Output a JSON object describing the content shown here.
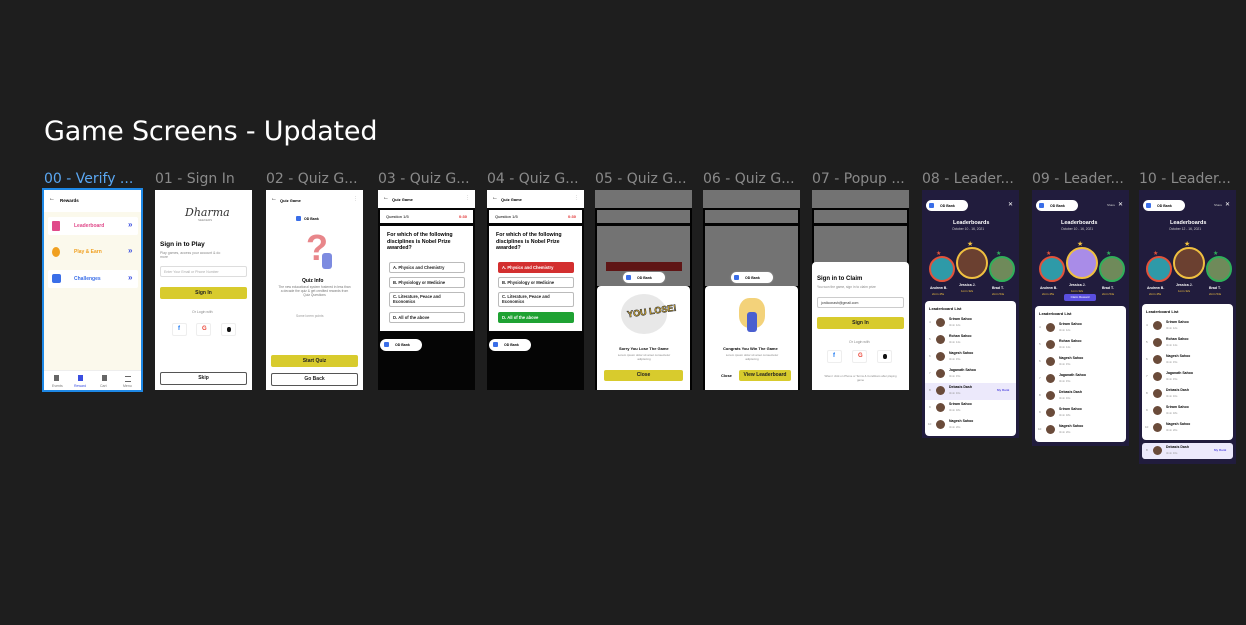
{
  "page": {
    "title": "Game Screens - Updated"
  },
  "frames": [
    {
      "label": "00 - Verify ..."
    },
    {
      "label": "01 - Sign In"
    },
    {
      "label": "02 - Quiz G..."
    },
    {
      "label": "03 - Quiz G..."
    },
    {
      "label": "04 - Quiz G..."
    },
    {
      "label": "05 - Quiz G..."
    },
    {
      "label": "06 - Quiz G..."
    },
    {
      "label": "07 - Popup ..."
    },
    {
      "label": "08 - Leader..."
    },
    {
      "label": "09 - Leader..."
    },
    {
      "label": "10 - Leader..."
    }
  ],
  "rewards": {
    "header": "Rewards",
    "items": [
      "Leaderboard",
      "Play & Earn",
      "Challenges"
    ],
    "nav": [
      "Events",
      "Reward",
      "Cart",
      "Menu"
    ],
    "colors": {
      "leaderboard": "#e04a8a",
      "play": "#f0a020",
      "challenges": "#3a6ee8"
    }
  },
  "signin": {
    "logo": "Dharma",
    "logo_sub": "SEEKERS",
    "title": "Sign in to Play",
    "subtitle": "Play games, access your account & do more",
    "input_placeholder": "Enter Your Email or Phone Number",
    "signin_button": "Sign In",
    "or_login": "Or Login with",
    "skip_button": "Skip"
  },
  "quiz_info": {
    "header": "Quiz Game",
    "badge": "OD Bank",
    "title": "Quiz Info",
    "body": "The new educational system fostered in less than a decade the quiz & get credited rewards from Quiz Questions",
    "points_line": "Some lorem points",
    "start_button": "Start Quiz",
    "back_button": "Go Back"
  },
  "quiz": {
    "header": "Quiz Game",
    "question_label": "Question 1/5",
    "timer": "0:30",
    "question": "For which of the following disciplines is Nobel Prize awarded?",
    "options": [
      "A. Physics and Chemistry",
      "B. Physiology or Medicine",
      "C. Literature, Peace and Economics",
      "D. All of the above"
    ],
    "badge": "OD Bank"
  },
  "lose": {
    "title": "Sorry You Lose The Game",
    "body": "Lorem ipsum dolor sit amet consectetur adipiscing",
    "badge": "OD Bank",
    "button": "Close",
    "stamp": "YOU LOSE!"
  },
  "win": {
    "title": "Congrats You Win The Game",
    "body": "Lorem ipsum dolor sit amet consectetur adipiscing",
    "badge": "OD Bank",
    "close": "Close",
    "leaderboard": "View Leaderboard"
  },
  "popup": {
    "title": "Sign in to Claim",
    "subtitle": "You won the game, sign in to claim prize",
    "email": "jordiconash@gmail.com",
    "signin_button": "Sign In",
    "or_login": "Or Login with",
    "terms": "When I click on Phone or Terms & Conditions after playing game"
  },
  "leaderboard": {
    "badge": "OD Bank",
    "title": "Leaderboards",
    "date": "October 10 - 16, 2021",
    "date_alt": "October 12 - 16, 2021",
    "share": "Share",
    "podium": [
      {
        "name": "Andrew B.",
        "score": "2min 45s"
      },
      {
        "name": "Jessica J.",
        "score": "1min 32s"
      },
      {
        "name": "Brad T.",
        "score": "2min 54s"
      }
    ],
    "claim_reward": "Claim Reward",
    "list_title": "Leaderboard List",
    "rows": [
      {
        "rank": "4",
        "name": "Sriram Sahoo",
        "time": "3min 12s"
      },
      {
        "rank": "5",
        "name": "Rohan Sahoo",
        "time": "3min 14s"
      },
      {
        "rank": "6",
        "name": "Nagesh Sahoo",
        "time": "3min 15s"
      },
      {
        "rank": "7",
        "name": "Jaganath Sahoo",
        "time": "3min 15s"
      },
      {
        "rank": "8",
        "name": "Debasis Dash",
        "time": "3min 16s"
      },
      {
        "rank": "9",
        "name": "Sriram Sahoo",
        "time": "3min 18s"
      },
      {
        "rank": "10",
        "name": "Nagesh Sahoo",
        "time": "3min 20s"
      }
    ],
    "my_rank": "My Rank",
    "my_name": "Debasis Dash",
    "my_time": "3min 16s"
  }
}
